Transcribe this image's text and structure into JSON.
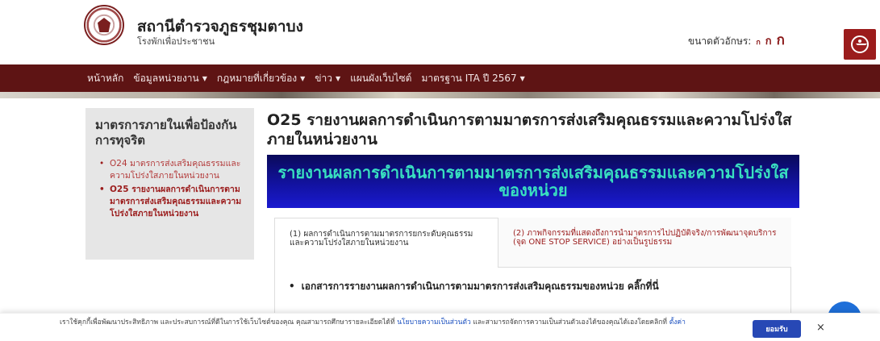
{
  "header": {
    "title": "สถานีตำรวจภูธรชุมตาบง",
    "subtitle": "โรงพักเพื่อประชาชน",
    "font_size_label": "ขนาดตัวอักษร:",
    "font_sizes": [
      "ก",
      "ก",
      "ก"
    ]
  },
  "nav": {
    "items": [
      {
        "label": "หน้าหลัก",
        "dropdown": false
      },
      {
        "label": "ข้อมูลหน่วยงาน",
        "dropdown": true
      },
      {
        "label": "กฎหมายที่เกี่ยวข้อง",
        "dropdown": true
      },
      {
        "label": "ข่าว",
        "dropdown": true
      },
      {
        "label": "แผนผังเว็บไซต์",
        "dropdown": false
      },
      {
        "label": "มาตรฐาน ITA ปี 2567",
        "dropdown": true
      }
    ],
    "caret": "▼"
  },
  "sidebar": {
    "title": "มาตรการภายในเพื่อป้องกันการทุจริต",
    "items": [
      {
        "label": "O24 มาตรการส่งเสริมคุณธรรมและความโปร่งใสภายในหน่วยงาน",
        "active": false
      },
      {
        "label": "O25 รายงานผลการดำเนินการตามมาตรการส่งเสริมคุณธรรมและความโปร่งใสภายในหน่วยงาน",
        "active": true
      }
    ]
  },
  "main": {
    "title": "O25 รายงานผลการดำเนินการตามมาตรการส่งเสริมคุณธรรมและความโปร่งใสภายในหน่วยงาน",
    "banner": "รายงานผลการดำเนินการตามมาตรการส่งเสริมคุณธรรมและความโปร่งใสของหน่วย",
    "tabs": [
      {
        "label": "(1) ผลการดำเนินการตามมาตรการยกระดับคุณธรรม และความโปร่งใสภายในหน่วยงาน"
      },
      {
        "label": "(2) ภาพกิจกรรมที่แสดงถึงการนำมาตรการไปปฏิบัติจริง/การพัฒนาจุดบริการ (จุด ONE STOP SERVICE) อย่างเป็นรูปธรรม"
      }
    ],
    "document_link": "เอกสารการรายงานผลการดำเนินการตามมาตรการส่งเสริมคุณธรรมของหน่วย คลิ๊กที่นี่"
  },
  "cookie": {
    "text_before": "เราใช้คุกกี้เพื่อพัฒนาประสิทธิภาพ และประสบการณ์ที่ดีในการใช้เว็บไซต์ของคุณ คุณสามารถศึกษารายละเอียดได้ที่ ",
    "privacy_link": "นโยบายความเป็นส่วนตัว",
    "text_after": " และสามารถจัดการความเป็นส่วนตัวเองได้ของคุณได้เองโดยคลิกที่ ",
    "settings_link": "ตั้งค่า",
    "accept": "ยอมรับ",
    "close": "×"
  },
  "colors": {
    "nav_bg": "#5e1414",
    "accent": "#9b1c1c",
    "banner_text": "#39e0c0",
    "banner_bg": "#1212a0"
  }
}
